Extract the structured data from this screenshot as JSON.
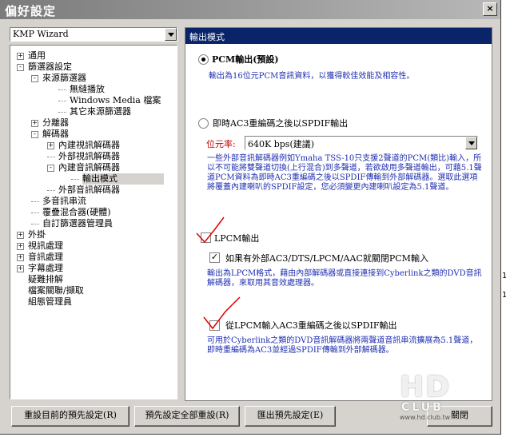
{
  "window": {
    "title": "偏好設定",
    "close_glyph": "×"
  },
  "profile": {
    "selected": "KMP Wizard"
  },
  "tree": [
    {
      "label": "通用",
      "level": 0,
      "expander": "+"
    },
    {
      "label": "篩選器設定",
      "level": 0,
      "expander": "-"
    },
    {
      "label": "來源篩選器",
      "level": 1,
      "expander": "-"
    },
    {
      "label": "無縫播放",
      "level": 3,
      "expander": ""
    },
    {
      "label": "Windows Media 檔案",
      "level": 3,
      "expander": ""
    },
    {
      "label": "其它來源篩選器",
      "level": 3,
      "expander": ""
    },
    {
      "label": "分離器",
      "level": 1,
      "expander": "+"
    },
    {
      "label": "解碼器",
      "level": 1,
      "expander": "-"
    },
    {
      "label": "內建視訊解碼器",
      "level": 2,
      "expander": "+"
    },
    {
      "label": "外部視訊解碼器",
      "level": 2,
      "expander": ""
    },
    {
      "label": "內建音訊解碼器",
      "level": 2,
      "expander": "-"
    },
    {
      "label": "輸出模式",
      "level": 4,
      "expander": "",
      "selected": true
    },
    {
      "label": "外部音訊解碼器",
      "level": 2,
      "expander": ""
    },
    {
      "label": "多音訊串流",
      "level": 1,
      "expander": ""
    },
    {
      "label": "覆疊混合器(硬體)",
      "level": 1,
      "expander": ""
    },
    {
      "label": "自訂篩選器管理員",
      "level": 1,
      "expander": ""
    },
    {
      "label": "外掛",
      "level": 0,
      "expander": "+"
    },
    {
      "label": "視訊處理",
      "level": 0,
      "expander": "+"
    },
    {
      "label": "音訊處理",
      "level": 0,
      "expander": "+"
    },
    {
      "label": "字幕處理",
      "level": 0,
      "expander": "+"
    },
    {
      "label": "疑難排解",
      "level": 0,
      "expander": ""
    },
    {
      "label": "檔案關聯/擷取",
      "level": 0,
      "expander": ""
    },
    {
      "label": "組態管理員",
      "level": 0,
      "expander": ""
    }
  ],
  "panel": {
    "header": "輸出模式",
    "pcm": {
      "label": "PCM輸出(預設)",
      "selected": true,
      "desc": "輸出為16位元PCM音訊資料，以獲得較佳效能及相容性。"
    },
    "spdif": {
      "label": "即時AC3重編碼之後以SPDIF輸出",
      "selected": false,
      "rate_label": "位元率:",
      "rate_value": "640K bps(建議)",
      "desc": "一些外部音訊解碼器例如Ymaha TSS-10只支援2聲道的PCM(類比)輸入，所以不可能將雙聲道切換(上行混合)到多聲道，若欲啟用多聲道輸出，可藉5.1聲道PCM資料為即時AC3重編碼之後以SPDIF傳輸到外部解碼器。選取此選項將覆蓋內建喇叭的SPDIF設定，您必須變更內建喇叭設定為5.1聲道。"
    },
    "lpcm": {
      "label": "LPCM輸出",
      "checked": true,
      "sub_label": "如果有外部AC3/DTS/LPCM/AAC就關閉PCM輸入",
      "sub_checked": true,
      "desc": "輸出為LPCM格式，藉由內部解碼器或直接連接到Cyberlink之類的DVD音訊解碼器，來取用其音效處理器。"
    },
    "lpcm_ac3": {
      "label": "從LPCM輸入AC3重編碼之後以SPDIF輸出",
      "checked": true,
      "desc": "可用於Cyberlink之類的DVD音訊解碼器將兩聲道音訊串流擴展為5.1聲道，即時重編碼為AC3並經過SPDIF傳輸到外部解碼器。"
    }
  },
  "buttons": {
    "reset_current": "重設目前的預先設定(R)",
    "reset_all": "預先設定全部重設(R)",
    "export": "匯出預先設定(E)",
    "close": "關閉"
  },
  "watermark": {
    "letters": "HD",
    "word": "CLUB",
    "url": "www.hd.club.tw"
  },
  "edge": {
    "mark1": "1",
    "mark2": "1"
  },
  "colors": {
    "header_bg": "#0a246a",
    "desc_text": "#1f2fb0",
    "rate_label": "#c00000",
    "annotation": "#e00000"
  }
}
